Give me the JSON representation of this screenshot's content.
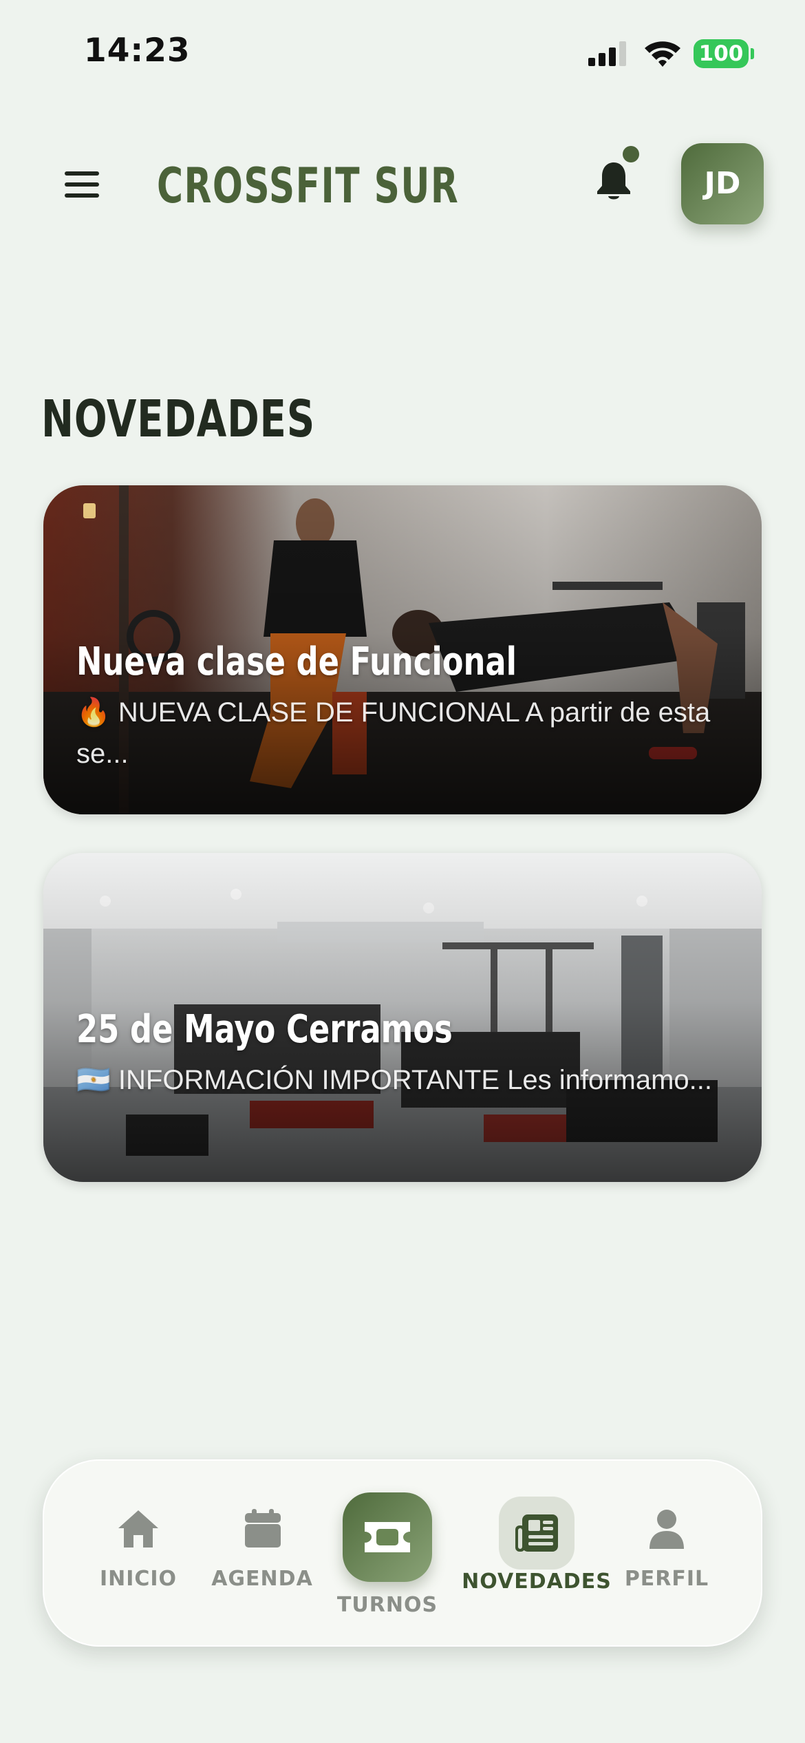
{
  "status_bar": {
    "time": "14:23",
    "battery": "100"
  },
  "header": {
    "title": "CROSSFIT SUR",
    "avatar_initials": "JD",
    "has_notification": true
  },
  "section": {
    "title": "NOVEDADES"
  },
  "news": [
    {
      "title": "Nueva clase de Funcional",
      "excerpt": "🔥 NUEVA CLASE DE FUNCIONAL A partir de esta se..."
    },
    {
      "title": "25 de Mayo Cerramos",
      "excerpt": "🇦🇷 INFORMACIÓN IMPORTANTE Les informamo..."
    }
  ],
  "nav": {
    "items": [
      {
        "label": "INICIO",
        "icon": "home-icon"
      },
      {
        "label": "AGENDA",
        "icon": "calendar-icon"
      },
      {
        "label": "TURNOS",
        "icon": "ticket-icon"
      },
      {
        "label": "NOVEDADES",
        "icon": "newspaper-icon",
        "active": true
      },
      {
        "label": "PERFIL",
        "icon": "person-icon"
      }
    ]
  },
  "colors": {
    "brand": "#4b6239",
    "background": "#eef3ee",
    "battery": "#35c759",
    "nav_inactive": "#8b8f89"
  }
}
